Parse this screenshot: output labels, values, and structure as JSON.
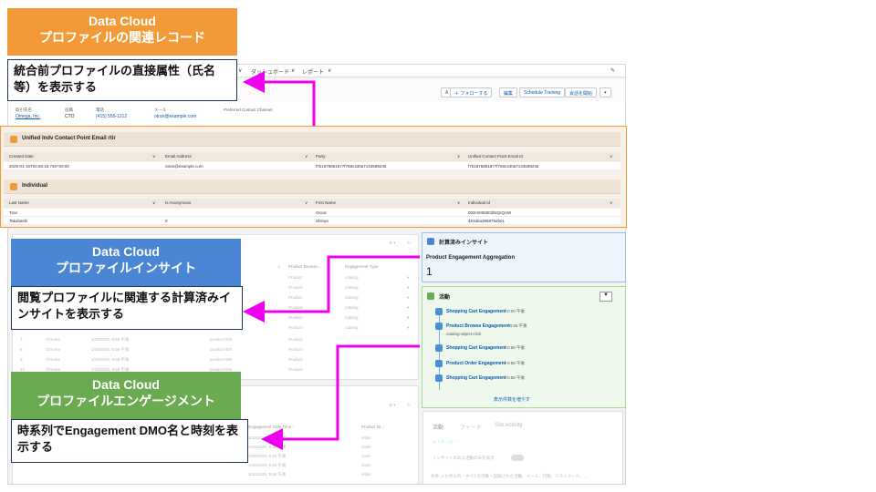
{
  "colors": {
    "orange": "#f29a38",
    "blue": "#4a86d4",
    "green": "#6aaa50",
    "magenta": "#ee00ee",
    "navy": "#1d3557"
  },
  "callouts": [
    {
      "title_line1": "Data Cloud",
      "title_line2": "プロファイルの関連レコード",
      "desc": "統合前プロファイルの直接属性（氏名等）を表示する"
    },
    {
      "title_line1": "Data Cloud",
      "title_line2": "プロファイルインサイト",
      "desc": "閲覧プロファイルに関連する計算済みインサイトを表示する"
    },
    {
      "title_line1": "Data Cloud",
      "title_line2": "プロファイルエンゲージメント",
      "desc": "時系列でEngagement DMO名と時刻を表示する"
    }
  ],
  "nav": {
    "dashboard": "ダッシュボード",
    "report": "レポート"
  },
  "header_buttons": {
    "follow": "＋ フォローする",
    "edit": "編集",
    "schedule": "Schedule Training",
    "meeting": "会話を開始"
  },
  "fields": {
    "company_label": "取引先名",
    "company_value": "Omega, Inc.",
    "title_label": "役職",
    "title_value": "CTO",
    "phone_label": "電話",
    "phone_value": "(415) 555-1212",
    "email_label": "メール",
    "email_value": "otran@example.com",
    "channel_label": "Preferred Contact Channel"
  },
  "card1": {
    "title": "Unified Indv Contact Point Email rtir",
    "columns": [
      "Created Date",
      "Email Address",
      "Party",
      "Unified Contact Point Email Id"
    ],
    "row": [
      "2025-01-16T04:56:16.740+00:00",
      "otran@example.com",
      "f7b1875851877f768c430a7143589245",
      "f7b1875851877f768c430a7143589245"
    ]
  },
  "card2": {
    "title": "Individual",
    "columns": [
      "Last Name",
      "Is Anonymous",
      "First Name",
      "Individual Id"
    ],
    "rows": [
      [
        "Tran",
        "",
        "Oscar",
        "003Hr000002lNQrQAW"
      ],
      [
        "Takahashi",
        "0",
        "Shinya",
        "463aba395875eb01"
      ]
    ]
  },
  "insight": {
    "heading": "計算済みインサイト",
    "name": "Product Engagement Aggregation",
    "value": "1"
  },
  "activity": {
    "heading": "活動",
    "items": [
      {
        "name": "Shopping Cart Engagement",
        "time": "• 0:00 午後",
        "sub": ""
      },
      {
        "name": "Product Browse Engagement",
        "time": "• 0:56 午後",
        "sub": "catalog-object-click"
      },
      {
        "name": "Shopping Cart Engagement",
        "time": "• 0:56 午後",
        "sub": ""
      },
      {
        "name": "Product Order Engagement",
        "time": "• 0:56 午後",
        "sub": ""
      },
      {
        "name": "Shopping Cart Engagement",
        "time": "• 0:56 午後",
        "sub": ""
      }
    ],
    "more": "表示件数を増やす"
  },
  "engagement_panel": {
    "cols": [
      "Product Browse...",
      "Engagement Type"
    ],
    "rows": [
      [
        "Product",
        "catalog"
      ],
      [
        "Product",
        "catalog"
      ],
      [
        "Product",
        "catalog"
      ],
      [
        "Product",
        "catalog"
      ],
      [
        "Product",
        "catalog"
      ],
      [
        "Product",
        "catalog"
      ]
    ],
    "lower_rows": [
      [
        "7",
        "Chrome",
        "1/16/2025, 5:59 午後",
        "product-015",
        "Product"
      ],
      [
        "8",
        "Chrome",
        "1/16/2025, 5:59 午後",
        "product-004",
        "Product"
      ],
      [
        "9",
        "Chrome",
        "1/16/2025, 5:59 午後",
        "product-005",
        "Product"
      ],
      [
        "10",
        "Chrome",
        "1/16/2025, 5:59 午後",
        "product-008",
        "Product"
      ]
    ]
  },
  "order_panel": {
    "cols": [
      "Engagement Date Time ↑",
      "Product Or..."
    ],
    "rows": [
      [
        "1/16/2025, 5:45 午後",
        "order"
      ],
      [
        "1/16/2025, 5:45 午後",
        "order"
      ],
      [
        "1/16/2025, 5:45 午後",
        "order"
      ],
      [
        "1/16/2025, 5:48 午後",
        "order"
      ],
      [
        "1/16/2025, 5:48 午後",
        "order"
      ]
    ]
  },
  "activity_tabs": {
    "tab1": "活動",
    "tab2": "フィード",
    "tab3": "Site Activity",
    "toggle_label": "インサイトのある活動のみを表示",
    "filter_text": "条件: 2 か月以内・すべての活動・記録された活動、メール、行動、リストメール、…"
  }
}
